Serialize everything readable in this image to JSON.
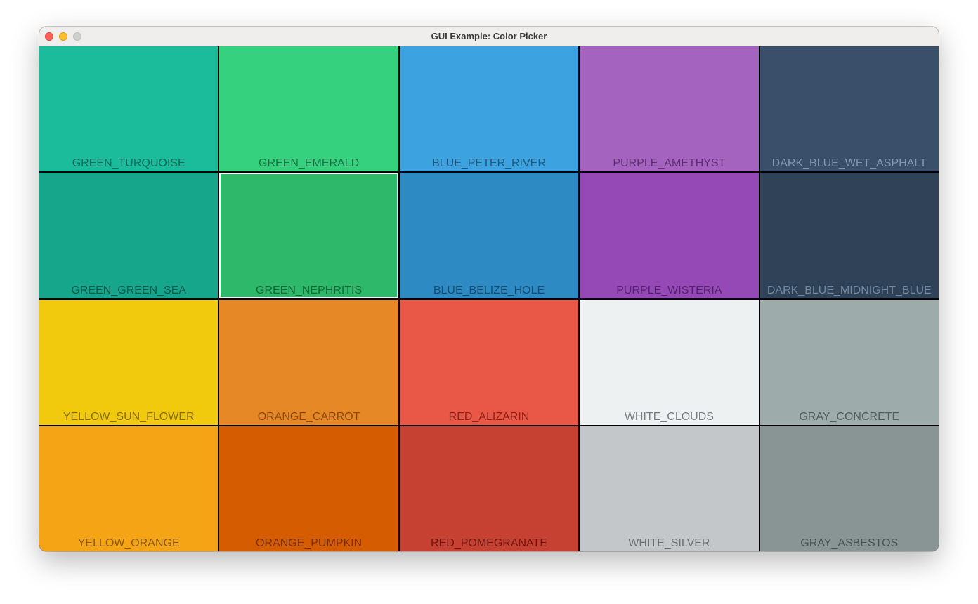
{
  "window": {
    "title": "GUI Example: Color Picker"
  },
  "selected_index": 6,
  "colors": [
    {
      "name": "GREEN_TURQUOISE",
      "hex": "#1abc9c",
      "text_color": "#0e6b58"
    },
    {
      "name": "GREEN_EMERALD",
      "hex": "#35d17e",
      "text_color": "#1c7444"
    },
    {
      "name": "BLUE_PETER_RIVER",
      "hex": "#3ca2e0",
      "text_color": "#1f5a80"
    },
    {
      "name": "PURPLE_AMETHYST",
      "hex": "#a463be",
      "text_color": "#5e2f72"
    },
    {
      "name": "DARK_BLUE_WET_ASPHALT",
      "hex": "#3a506a",
      "text_color": "#7e97b3"
    },
    {
      "name": "GREEN_GREEN_SEA",
      "hex": "#16a68c",
      "text_color": "#0a5a4b"
    },
    {
      "name": "GREEN_NEPHRITIS",
      "hex": "#2db86a",
      "text_color": "#15663a"
    },
    {
      "name": "BLUE_BELIZE_HOLE",
      "hex": "#2d8ac2",
      "text_color": "#164d70"
    },
    {
      "name": "PURPLE_WISTERIA",
      "hex": "#9549b6",
      "text_color": "#55236c"
    },
    {
      "name": "DARK_BLUE_MIDNIGHT_BLUE",
      "hex": "#2f4257",
      "text_color": "#6f89a5"
    },
    {
      "name": "YELLOW_SUN_FLOWER",
      "hex": "#f1ca0d",
      "text_color": "#8a6f04"
    },
    {
      "name": "ORANGE_CARROT",
      "hex": "#e78826",
      "text_color": "#8a4a0c"
    },
    {
      "name": "RED_ALIZARIN",
      "hex": "#e95747",
      "text_color": "#8c231a"
    },
    {
      "name": "WHITE_CLOUDS",
      "hex": "#eef1f2",
      "text_color": "#7b7e80"
    },
    {
      "name": "GRAY_CONCRETE",
      "hex": "#9eabab",
      "text_color": "#545e5e"
    },
    {
      "name": "YELLOW_ORANGE",
      "hex": "#f4a414",
      "text_color": "#8c5a04"
    },
    {
      "name": "ORANGE_PUMPKIN",
      "hex": "#d65c00",
      "text_color": "#7c2f00"
    },
    {
      "name": "RED_POMEGRANATE",
      "hex": "#c64132",
      "text_color": "#701810"
    },
    {
      "name": "WHITE_SILVER",
      "hex": "#c3c7ca",
      "text_color": "#6d7174"
    },
    {
      "name": "GRAY_ASBESTOS",
      "hex": "#899595",
      "text_color": "#4a5252"
    }
  ]
}
